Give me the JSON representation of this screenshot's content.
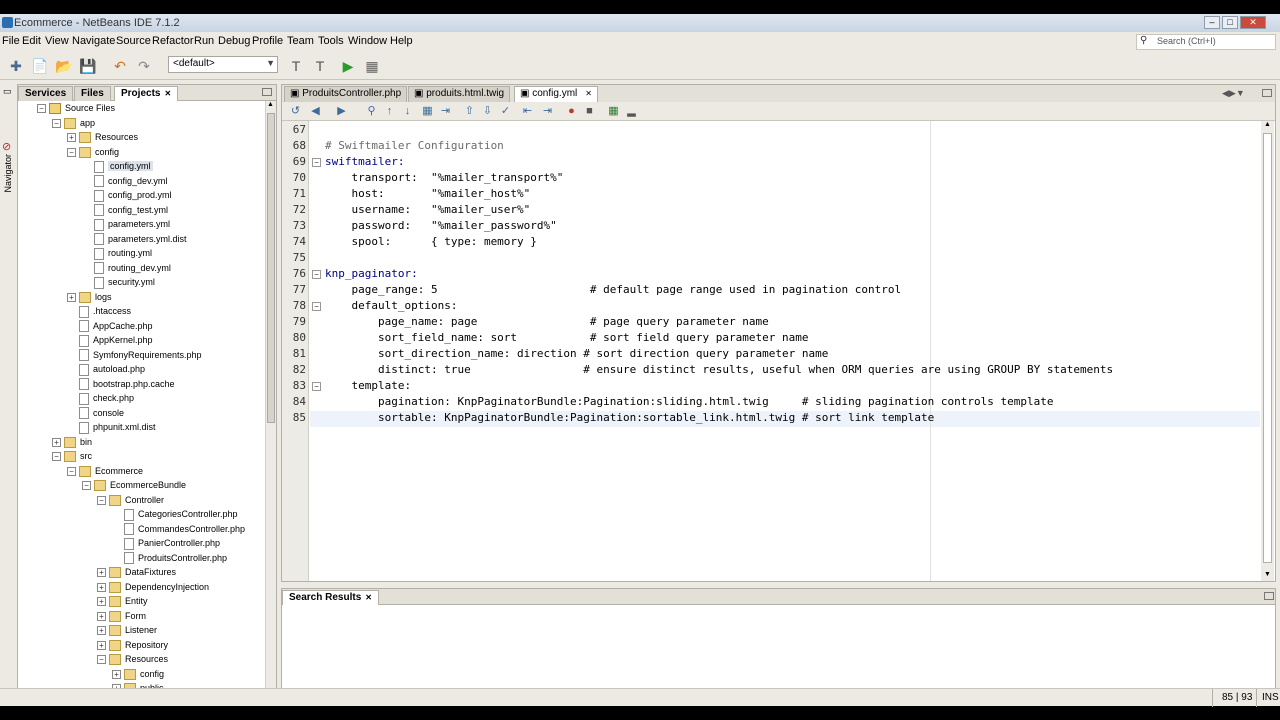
{
  "window": {
    "title": "Ecommerce - NetBeans IDE 7.1.2"
  },
  "menu": [
    "File",
    "Edit",
    "View",
    "Navigate",
    "Source",
    "Refactor",
    "Run",
    "Debug",
    "Profile",
    "Team",
    "Tools",
    "Window",
    "Help"
  ],
  "search": {
    "placeholder": "Search (Ctrl+I)"
  },
  "toolbar": {
    "config_value": "<default>"
  },
  "navigator_label": "Navigator",
  "left_tabs": [
    {
      "label": "Services"
    },
    {
      "label": "Files"
    },
    {
      "label": "Projects"
    }
  ],
  "tree": [
    {
      "label": "Source Files",
      "indent": 1,
      "kind": "pkg",
      "exp": "-"
    },
    {
      "label": "app",
      "indent": 2,
      "kind": "folder",
      "exp": "-"
    },
    {
      "label": "Resources",
      "indent": 3,
      "kind": "folder",
      "exp": "+"
    },
    {
      "label": "config",
      "indent": 3,
      "kind": "folder",
      "exp": "-"
    },
    {
      "label": "config.yml",
      "indent": 4,
      "kind": "file",
      "exp": ""
    },
    {
      "label": "config_dev.yml",
      "indent": 4,
      "kind": "file",
      "exp": ""
    },
    {
      "label": "config_prod.yml",
      "indent": 4,
      "kind": "file",
      "exp": ""
    },
    {
      "label": "config_test.yml",
      "indent": 4,
      "kind": "file",
      "exp": ""
    },
    {
      "label": "parameters.yml",
      "indent": 4,
      "kind": "file",
      "exp": ""
    },
    {
      "label": "parameters.yml.dist",
      "indent": 4,
      "kind": "file",
      "exp": ""
    },
    {
      "label": "routing.yml",
      "indent": 4,
      "kind": "file",
      "exp": ""
    },
    {
      "label": "routing_dev.yml",
      "indent": 4,
      "kind": "file",
      "exp": ""
    },
    {
      "label": "security.yml",
      "indent": 4,
      "kind": "file",
      "exp": ""
    },
    {
      "label": "logs",
      "indent": 3,
      "kind": "folder",
      "exp": "+"
    },
    {
      "label": ".htaccess",
      "indent": 3,
      "kind": "file",
      "exp": ""
    },
    {
      "label": "AppCache.php",
      "indent": 3,
      "kind": "file",
      "exp": ""
    },
    {
      "label": "AppKernel.php",
      "indent": 3,
      "kind": "file",
      "exp": ""
    },
    {
      "label": "SymfonyRequirements.php",
      "indent": 3,
      "kind": "file",
      "exp": ""
    },
    {
      "label": "autoload.php",
      "indent": 3,
      "kind": "file",
      "exp": ""
    },
    {
      "label": "bootstrap.php.cache",
      "indent": 3,
      "kind": "file",
      "exp": ""
    },
    {
      "label": "check.php",
      "indent": 3,
      "kind": "file",
      "exp": ""
    },
    {
      "label": "console",
      "indent": 3,
      "kind": "file",
      "exp": ""
    },
    {
      "label": "phpunit.xml.dist",
      "indent": 3,
      "kind": "file",
      "exp": ""
    },
    {
      "label": "bin",
      "indent": 2,
      "kind": "folder",
      "exp": "+"
    },
    {
      "label": "src",
      "indent": 2,
      "kind": "folder",
      "exp": "-"
    },
    {
      "label": "Ecommerce",
      "indent": 3,
      "kind": "folder",
      "exp": "-"
    },
    {
      "label": "EcommerceBundle",
      "indent": 4,
      "kind": "folder",
      "exp": "-"
    },
    {
      "label": "Controller",
      "indent": 5,
      "kind": "folder",
      "exp": "-"
    },
    {
      "label": "CategoriesController.php",
      "indent": 6,
      "kind": "file",
      "exp": ""
    },
    {
      "label": "CommandesController.php",
      "indent": 6,
      "kind": "file",
      "exp": ""
    },
    {
      "label": "PanierController.php",
      "indent": 6,
      "kind": "file",
      "exp": ""
    },
    {
      "label": "ProduitsController.php",
      "indent": 6,
      "kind": "file",
      "exp": ""
    },
    {
      "label": "DataFixtures",
      "indent": 5,
      "kind": "folder",
      "exp": "+"
    },
    {
      "label": "DependencyInjection",
      "indent": 5,
      "kind": "folder",
      "exp": "+"
    },
    {
      "label": "Entity",
      "indent": 5,
      "kind": "folder",
      "exp": "+"
    },
    {
      "label": "Form",
      "indent": 5,
      "kind": "folder",
      "exp": "+"
    },
    {
      "label": "Listener",
      "indent": 5,
      "kind": "folder",
      "exp": "+"
    },
    {
      "label": "Repository",
      "indent": 5,
      "kind": "folder",
      "exp": "+"
    },
    {
      "label": "Resources",
      "indent": 5,
      "kind": "folder",
      "exp": "-"
    },
    {
      "label": "config",
      "indent": 6,
      "kind": "folder",
      "exp": "+"
    },
    {
      "label": "public",
      "indent": 6,
      "kind": "folder",
      "exp": "+"
    }
  ],
  "editor_tabs": [
    {
      "label": "ProduitsController.php"
    },
    {
      "label": "produits.html.twig"
    },
    {
      "label": "config.yml"
    }
  ],
  "code_lines": [
    {
      "num": "67",
      "text": "",
      "fold": ""
    },
    {
      "num": "68",
      "text": "# Swiftmailer Configuration",
      "fold": "",
      "kind": "comment"
    },
    {
      "num": "69",
      "text": "swiftmailer:",
      "fold": "-",
      "kind": "key"
    },
    {
      "num": "70",
      "text": "    transport:  \"%mailer_transport%\"",
      "fold": ""
    },
    {
      "num": "71",
      "text": "    host:       \"%mailer_host%\"",
      "fold": ""
    },
    {
      "num": "72",
      "text": "    username:   \"%mailer_user%\"",
      "fold": ""
    },
    {
      "num": "73",
      "text": "    password:   \"%mailer_password%\"",
      "fold": ""
    },
    {
      "num": "74",
      "text": "    spool:      { type: memory }",
      "fold": ""
    },
    {
      "num": "75",
      "text": "",
      "fold": ""
    },
    {
      "num": "76",
      "text": "knp_paginator:",
      "fold": "-",
      "kind": "key"
    },
    {
      "num": "77",
      "text": "    page_range: 5                       # default page range used in pagination control",
      "fold": ""
    },
    {
      "num": "78",
      "text": "    default_options:",
      "fold": "-"
    },
    {
      "num": "79",
      "text": "        page_name: page                 # page query parameter name",
      "fold": ""
    },
    {
      "num": "80",
      "text": "        sort_field_name: sort           # sort field query parameter name",
      "fold": ""
    },
    {
      "num": "81",
      "text": "        sort_direction_name: direction # sort direction query parameter name",
      "fold": ""
    },
    {
      "num": "82",
      "text": "        distinct: true                 # ensure distinct results, useful when ORM queries are using GROUP BY statements",
      "fold": ""
    },
    {
      "num": "83",
      "text": "    template:",
      "fold": "-"
    },
    {
      "num": "84",
      "text": "        pagination: KnpPaginatorBundle:Pagination:sliding.html.twig     # sliding pagination controls template",
      "fold": ""
    },
    {
      "num": "85",
      "text": "        sortable: KnpPaginatorBundle:Pagination:sortable_link.html.twig # sort link template",
      "fold": ""
    }
  ],
  "bottom_tabs": [
    {
      "label": "Search Results"
    }
  ],
  "status": {
    "position": "85 | 93",
    "mode": "INS"
  }
}
